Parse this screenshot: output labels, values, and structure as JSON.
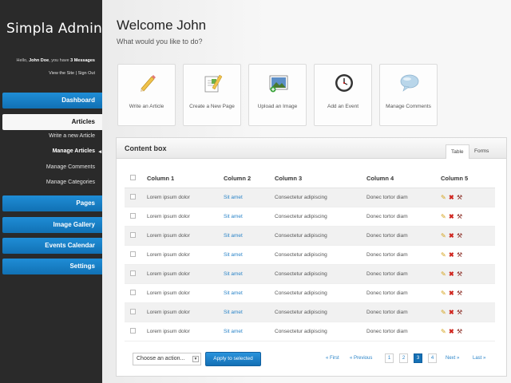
{
  "sidebar": {
    "logo": "Simpla Admin",
    "greeting": {
      "hello": "Hello, ",
      "name": "John Doe",
      "mid": ", you have ",
      "messages": "3 Messages"
    },
    "links": {
      "view_site": "View the Site",
      "separator": " | ",
      "sign_out": "Sign Out"
    },
    "nav": [
      {
        "label": "Dashboard"
      },
      {
        "label": "Articles"
      },
      {
        "label": "Pages"
      },
      {
        "label": "Image Gallery"
      },
      {
        "label": "Events Calendar"
      },
      {
        "label": "Settings"
      }
    ],
    "subitems": [
      {
        "label": "Write a new Article"
      },
      {
        "label": "Manage Articles"
      },
      {
        "label": "Manage Comments"
      },
      {
        "label": "Manage Categories"
      }
    ]
  },
  "main": {
    "title": "Welcome John",
    "subtitle": "What would you like to do?",
    "shortcuts": [
      {
        "label": "Write an Article",
        "icon": "pencil-icon"
      },
      {
        "label": "Create a New Page",
        "icon": "page-edit-icon"
      },
      {
        "label": "Upload an Image",
        "icon": "image-upload-icon"
      },
      {
        "label": "Add an Event",
        "icon": "clock-icon"
      },
      {
        "label": "Manage Comments",
        "icon": "speech-bubble-icon"
      }
    ]
  },
  "content_box": {
    "title": "Content box",
    "tabs": [
      {
        "label": "Table"
      },
      {
        "label": "Forms"
      }
    ],
    "columns": [
      "Column 1",
      "Column 2",
      "Column 3",
      "Column 4",
      "Column 5"
    ],
    "rows": [
      [
        "Lorem ipsum dolor",
        "Sit amet",
        "Consectetur adipiscing",
        "Donec tortor diam"
      ],
      [
        "Lorem ipsum dolor",
        "Sit amet",
        "Consectetur adipiscing",
        "Donec tortor diam"
      ],
      [
        "Lorem ipsum dolor",
        "Sit amet",
        "Consectetur adipiscing",
        "Donec tortor diam"
      ],
      [
        "Lorem ipsum dolor",
        "Sit amet",
        "Consectetur adipiscing",
        "Donec tortor diam"
      ],
      [
        "Lorem ipsum dolor",
        "Sit amet",
        "Consectetur adipiscing",
        "Donec tortor diam"
      ],
      [
        "Lorem ipsum dolor",
        "Sit amet",
        "Consectetur adipiscing",
        "Donec tortor diam"
      ],
      [
        "Lorem ipsum dolor",
        "Sit amet",
        "Consectetur adipiscing",
        "Donec tortor diam"
      ],
      [
        "Lorem ipsum dolor",
        "Sit amet",
        "Consectetur adipiscing",
        "Donec tortor diam"
      ]
    ],
    "bulk_action": "Choose an action...",
    "apply_label": "Apply to selected",
    "pagination": {
      "first": "« First",
      "previous": "« Previous",
      "pages": [
        "1",
        "2",
        "3",
        "4"
      ],
      "current_page": "3",
      "next": "Next »",
      "last": "Last »"
    }
  },
  "colors": {
    "accent": "#1a7fc9",
    "sidebar_bg": "#2a2a2a",
    "link": "#2a84c8",
    "delete": "#d0261f",
    "edit": "#d4a21b"
  }
}
